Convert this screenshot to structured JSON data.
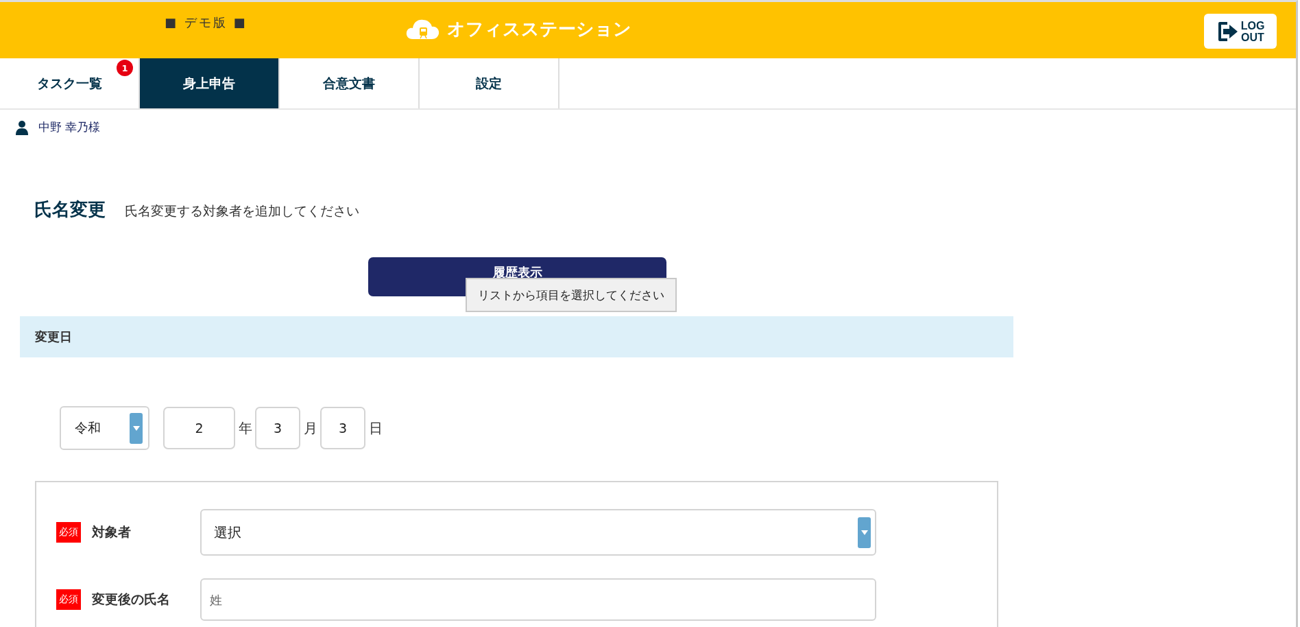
{
  "header": {
    "demo_label": "■ デモ版 ■",
    "logo_text": "オフィスステーション",
    "logout": {
      "line1": "LOG",
      "line2": "OUT"
    }
  },
  "tabs": [
    {
      "label": "タスク一覧",
      "selected": false,
      "badge": "1"
    },
    {
      "label": "身上申告",
      "selected": true
    },
    {
      "label": "合意文書",
      "selected": false
    },
    {
      "label": "設定",
      "selected": false
    }
  ],
  "user": {
    "name": "中野 幸乃様"
  },
  "section": {
    "title": "氏名変更",
    "description": "氏名変更する対象者を追加してください"
  },
  "history_button": {
    "label": "履歴表示"
  },
  "tooltip": {
    "text": "リストから項目を選択してください"
  },
  "date_section": {
    "header": "変更日",
    "era": "令和",
    "fields": [
      {
        "value": "2",
        "unit": "年"
      },
      {
        "value": "3",
        "unit": "月"
      },
      {
        "value": "3",
        "unit": "日"
      }
    ]
  },
  "form": {
    "rows": [
      {
        "required": "必須",
        "label": "対象者",
        "kind": "select",
        "value": "選択"
      },
      {
        "required": "必須",
        "label": "変更後の氏名",
        "kind": "input",
        "placeholder": "姓"
      }
    ]
  }
}
